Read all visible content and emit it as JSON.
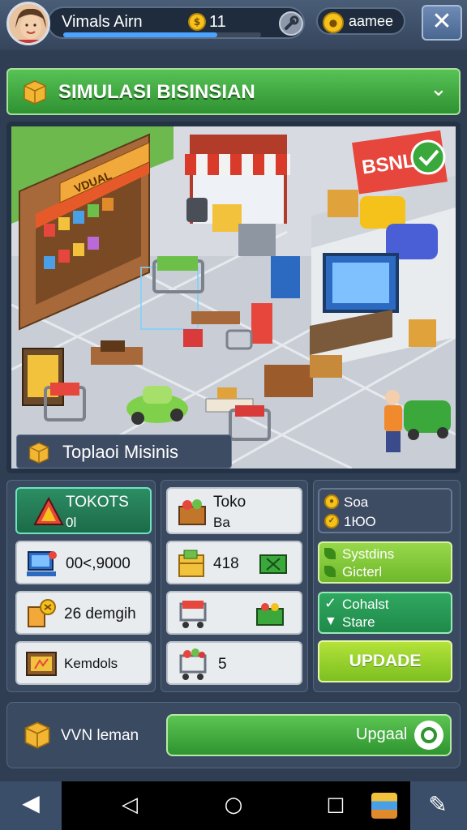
{
  "header": {
    "player_name": "Vimals Airn",
    "coin_count": "11",
    "gold_label": "aamee",
    "xp_progress": 0.78,
    "close_label": "✕"
  },
  "title_banner": {
    "title": "SIMULASI BISINSIAN"
  },
  "scene": {
    "label": "Toplaoi Misinis",
    "sign_left": "VDUAL",
    "sign_right": "BSNLIE"
  },
  "cards_left": [
    {
      "title": "TOKOTS",
      "subtitle": "0l"
    },
    {
      "title": "00<,9000",
      "subtitle": ""
    },
    {
      "title": "26 demgih",
      "subtitle": ""
    },
    {
      "title": "Kemdols",
      "subtitle": ""
    }
  ],
  "cards_middle": [
    {
      "title": "Toko",
      "subtitle": "Ba"
    },
    {
      "title": "418",
      "subtitle": ""
    },
    {
      "title": "",
      "subtitle": ""
    },
    {
      "title": "5",
      "subtitle": ""
    }
  ],
  "side": {
    "stat_line1": "Soa",
    "stat_line2": "1ЮО",
    "systems_line1": "Systdins",
    "systems_line2": "Gicterl",
    "cohalst_line1": "Cohalst",
    "cohalst_line2": "Stare",
    "update_label": "UPDADE"
  },
  "bottom": {
    "left_label": "VVN leman",
    "upgrade_label": "Upgaal"
  },
  "colors": {
    "accent_green": "#3aa83a",
    "teal_card": "#1f7a55",
    "lime_button": "#8ccf3a"
  }
}
